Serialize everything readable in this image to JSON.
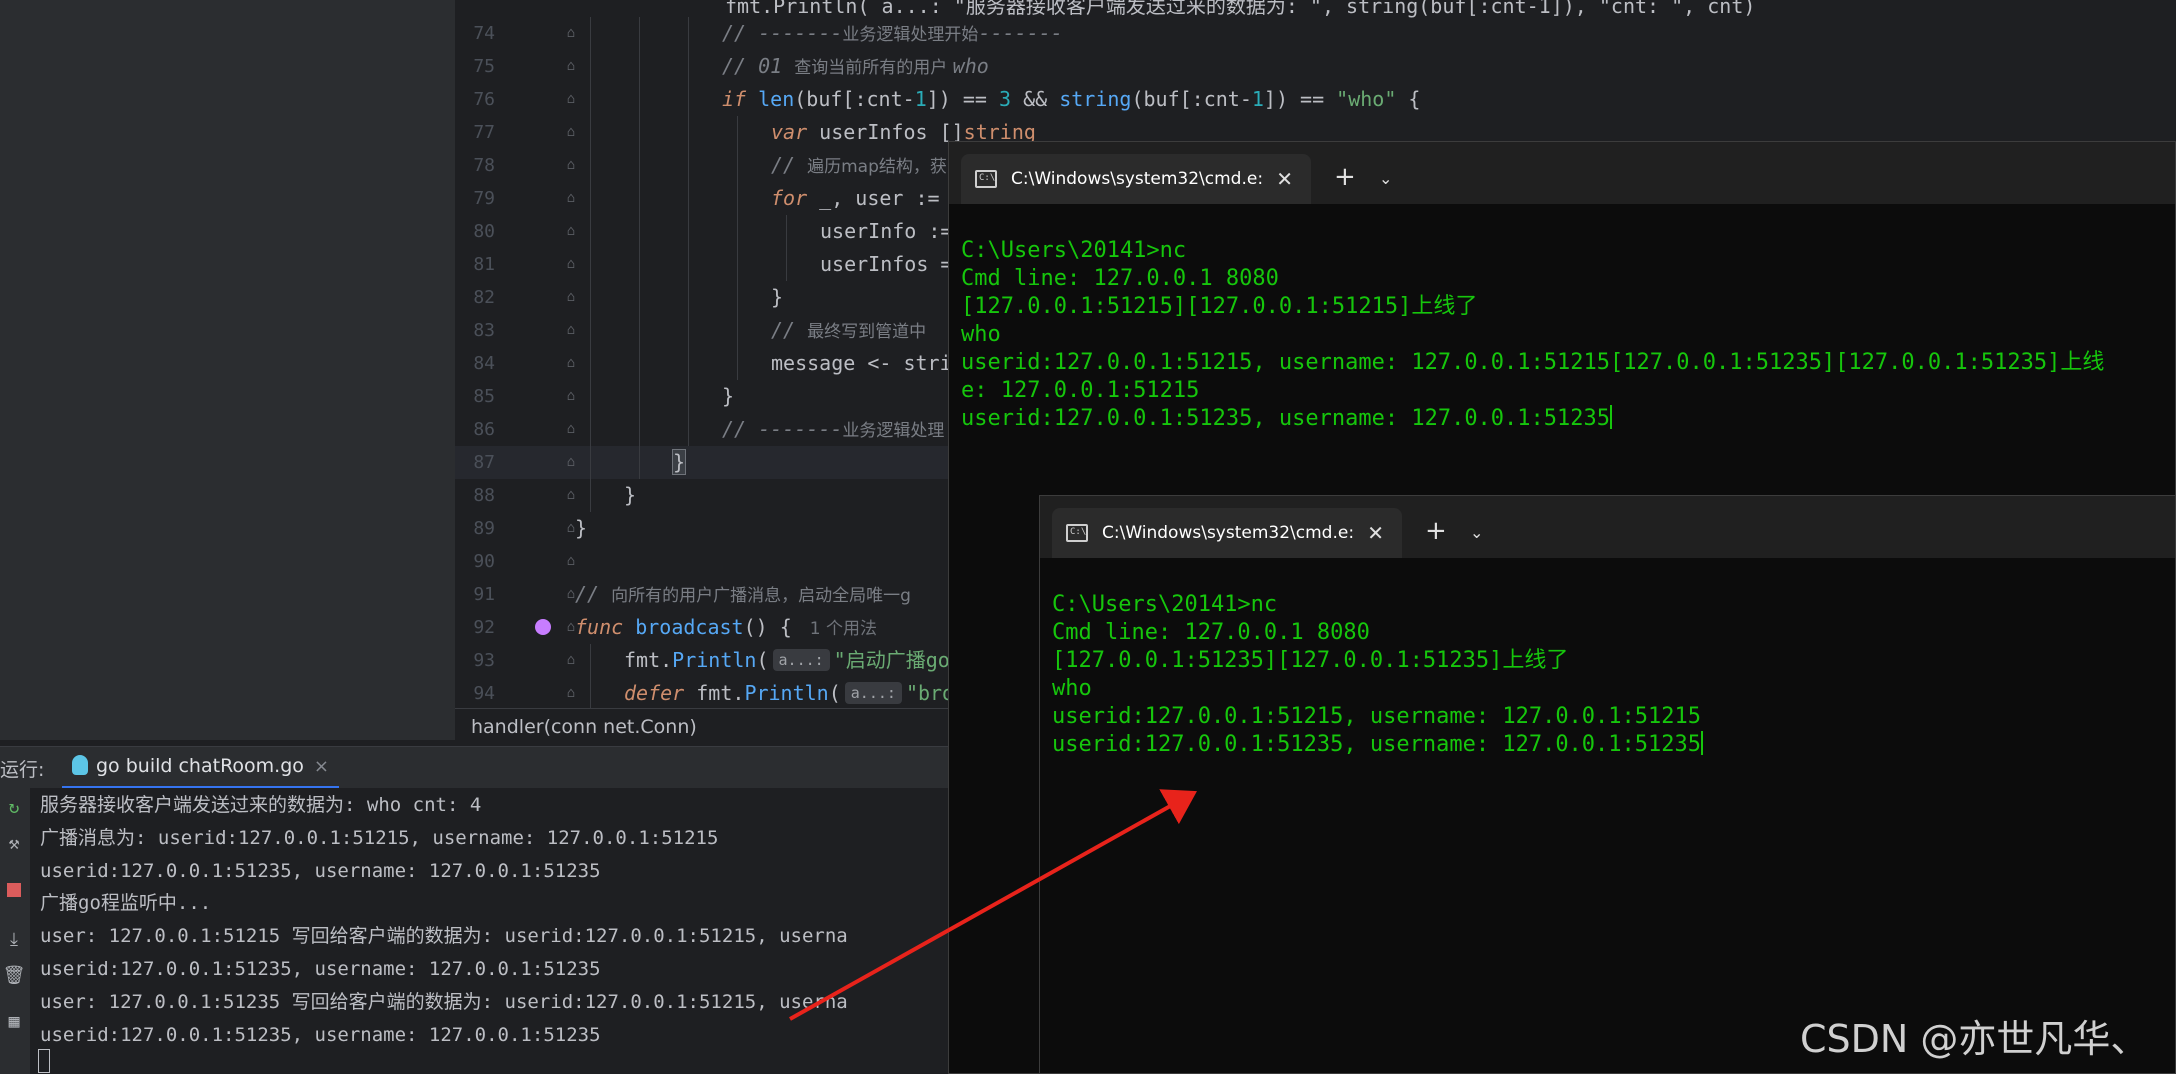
{
  "editor": {
    "lines": [
      {
        "n": "74",
        "indent": 3,
        "tokens": [
          [
            "cm",
            "// -------"
          ],
          [
            "cmz",
            "业务逻辑处理开始"
          ],
          [
            "cm",
            "-------"
          ]
        ]
      },
      {
        "n": "75",
        "indent": 3,
        "tokens": [
          [
            "cm",
            "// 01 "
          ],
          [
            "cmz",
            "查询当前所有的用户 "
          ],
          [
            "cm",
            "who"
          ]
        ]
      },
      {
        "n": "76",
        "indent": 3,
        "tokens": [
          [
            "kw",
            "if"
          ],
          [
            "p",
            " "
          ],
          [
            "fn",
            "len"
          ],
          [
            "p",
            "(buf[:cnt-"
          ],
          [
            "num",
            "1"
          ],
          [
            "p",
            "]) == "
          ],
          [
            "num",
            "3"
          ],
          [
            "p",
            " && "
          ],
          [
            "fn",
            "string"
          ],
          [
            "p",
            "(buf[:cnt-"
          ],
          [
            "num",
            "1"
          ],
          [
            "p",
            "]) == "
          ],
          [
            "str",
            "\"who\""
          ],
          [
            "p",
            " {"
          ]
        ]
      },
      {
        "n": "77",
        "indent": 4,
        "tokens": [
          [
            "kw",
            "var"
          ],
          [
            "p",
            " userInfos []"
          ],
          [
            "ty",
            "string"
          ]
        ]
      },
      {
        "n": "78",
        "indent": 4,
        "tokens": [
          [
            "cm",
            "// "
          ],
          [
            "cmz",
            "遍历map结构，获"
          ]
        ]
      },
      {
        "n": "79",
        "indent": 4,
        "tokens": [
          [
            "kw",
            "for"
          ],
          [
            "p",
            " _, user :="
          ]
        ]
      },
      {
        "n": "80",
        "indent": 5,
        "tokens": [
          [
            "p",
            "userInfo :="
          ]
        ]
      },
      {
        "n": "81",
        "indent": 5,
        "tokens": [
          [
            "p",
            "userInfos ="
          ]
        ]
      },
      {
        "n": "82",
        "indent": 4,
        "tokens": [
          [
            "p",
            "}"
          ]
        ]
      },
      {
        "n": "83",
        "indent": 4,
        "tokens": [
          [
            "cm",
            "// "
          ],
          [
            "cmz",
            "最终写到管道中"
          ]
        ]
      },
      {
        "n": "84",
        "indent": 4,
        "tokens": [
          [
            "p",
            "message <- stri"
          ]
        ]
      },
      {
        "n": "85",
        "indent": 3,
        "tokens": [
          [
            "p",
            "}"
          ]
        ]
      },
      {
        "n": "86",
        "indent": 3,
        "tokens": [
          [
            "cm",
            "// -------"
          ],
          [
            "cmz",
            "业务逻辑处理"
          ]
        ]
      },
      {
        "n": "87",
        "indent": 2,
        "current": true,
        "tokens": [
          [
            "hl",
            "}"
          ]
        ]
      },
      {
        "n": "88",
        "indent": 1,
        "tokens": [
          [
            "p",
            "}"
          ]
        ]
      },
      {
        "n": "89",
        "indent": 0,
        "tokens": [
          [
            "p",
            "}"
          ]
        ]
      },
      {
        "n": "90",
        "indent": 0,
        "tokens": []
      },
      {
        "n": "91",
        "indent": 0,
        "tokens": [
          [
            "cm",
            "// "
          ],
          [
            "cmz",
            "向所有的用户广播消息，启动全局唯一g"
          ]
        ]
      },
      {
        "n": "92",
        "indent": 0,
        "tokens": [
          [
            "kw",
            "func"
          ],
          [
            "p",
            " "
          ],
          [
            "fn",
            "broadcast"
          ],
          [
            "p",
            "() {"
          ],
          [
            "usage",
            "1 个用法"
          ]
        ]
      },
      {
        "n": "93",
        "indent": 1,
        "tokens": [
          [
            "p",
            "fmt."
          ],
          [
            "fn",
            "Println"
          ],
          [
            "p",
            "("
          ],
          [
            "hint",
            "a...:"
          ],
          [
            "str",
            "\"启动广播go程"
          ]
        ]
      },
      {
        "n": "94",
        "indent": 1,
        "tokens": [
          [
            "kw",
            "defer"
          ],
          [
            "p",
            " fmt."
          ],
          [
            "fn",
            "Println"
          ],
          [
            "p",
            "("
          ],
          [
            "hint",
            "a...:"
          ],
          [
            "str",
            "\"broa"
          ]
        ]
      }
    ],
    "top_partial": "fmt.Println( a...: \"服务器接收客户端发送过来的数据为: \", string(buf[:cnt-1]), \"cnt: \", cnt)"
  },
  "breadcrumb": "handler(conn net.Conn)",
  "run_panel": {
    "label": "运行:",
    "tab_label": "go build chatRoom.go",
    "tab_close": "×",
    "console_lines": [
      "服务器接收客户端发送过来的数据为: who cnt: 4",
      "广播消息为: userid:127.0.0.1:51215, username: 127.0.0.1:51215",
      "userid:127.0.0.1:51235, username: 127.0.0.1:51235",
      "广播go程监听中...",
      "user: 127.0.0.1:51215 写回给客户端的数据为: userid:127.0.0.1:51215, userna",
      "userid:127.0.0.1:51235, username: 127.0.0.1:51235",
      "user: 127.0.0.1:51235 写回给客户端的数据为: userid:127.0.0.1:51215, userna",
      "userid:127.0.0.1:51235, username: 127.0.0.1:51235"
    ]
  },
  "terminal1": {
    "tab_title": "C:\\Windows\\system32\\cmd.e:",
    "new_tab": "+",
    "dropdown": "⌄",
    "close": "✕",
    "lines": [
      "C:\\Users\\20141>nc",
      "Cmd line: 127.0.0.1 8080",
      "[127.0.0.1:51215][127.0.0.1:51215]上线了",
      "who",
      "userid:127.0.0.1:51215, username: 127.0.0.1:51215[127.0.0.1:51235][127.0.0.1:51235]上线",
      "e: 127.0.0.1:51215",
      "userid:127.0.0.1:51235, username: 127.0.0.1:51235"
    ]
  },
  "terminal2": {
    "tab_title": "C:\\Windows\\system32\\cmd.e:",
    "new_tab": "+",
    "dropdown": "⌄",
    "close": "✕",
    "lines": [
      "C:\\Users\\20141>nc",
      "Cmd line: 127.0.0.1 8080",
      "[127.0.0.1:51235][127.0.0.1:51235]上线了",
      "who",
      "userid:127.0.0.1:51215, username: 127.0.0.1:51215",
      "userid:127.0.0.1:51235, username: 127.0.0.1:51235"
    ]
  },
  "watermark": "CSDN @亦世凡华、",
  "colors": {
    "terminal_text": "#16c60c",
    "arrow": "#e8231b",
    "run_tab_accent": "#3574f0"
  }
}
